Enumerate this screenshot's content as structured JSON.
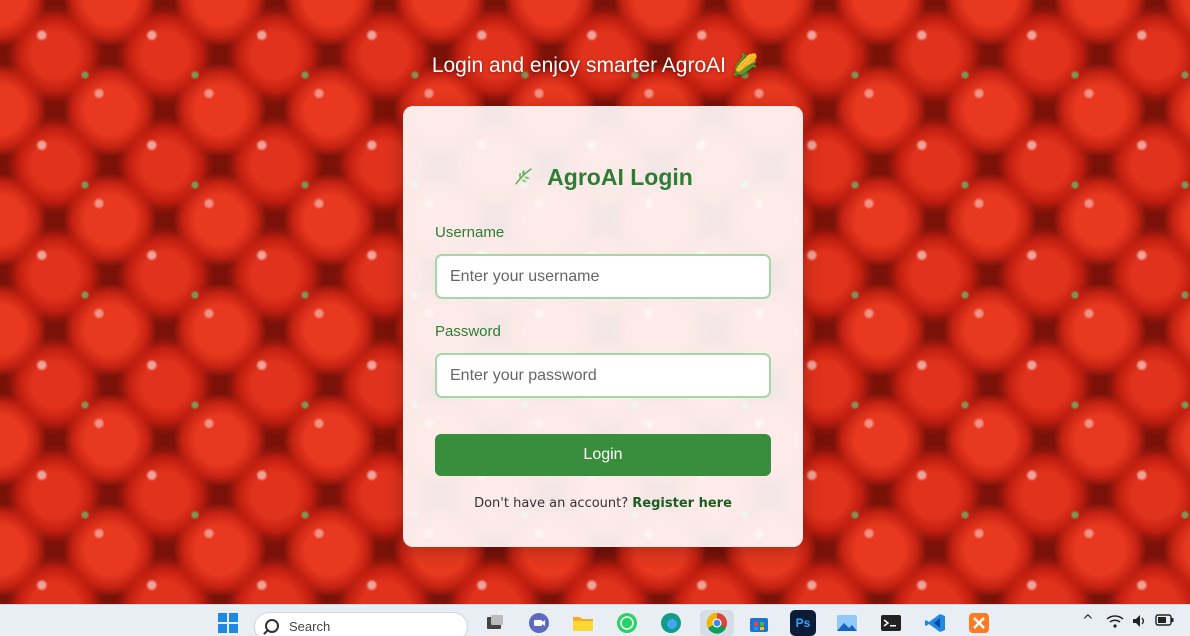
{
  "tagline": {
    "text": "Login and enjoy smarter AgroAI",
    "emoji": "🌽"
  },
  "card": {
    "title": "AgroAI Login",
    "title_icon": "🌿",
    "username_label": "Username",
    "username_placeholder": "Enter your username",
    "username_value": "",
    "password_label": "Password",
    "password_placeholder": "Enter your password",
    "password_value": "",
    "login_label": "Login",
    "register_prompt": "Don't have an account?",
    "register_link": "Register here"
  },
  "taskbar": {
    "search_placeholder": "Search",
    "icons": [
      "windows-start-icon",
      "search-icon",
      "task-view-icon",
      "meet-icon",
      "file-explorer-icon",
      "whatsapp-icon",
      "edge-icon",
      "chrome-icon",
      "store-icon",
      "photoshop-icon",
      "photos-icon",
      "terminal-icon",
      "vscode-icon",
      "xampp-icon"
    ],
    "photoshop_label": "Ps"
  },
  "colors": {
    "accent": "#2e7d32",
    "button": "#388e3c",
    "input_border": "#a5d6a7"
  }
}
